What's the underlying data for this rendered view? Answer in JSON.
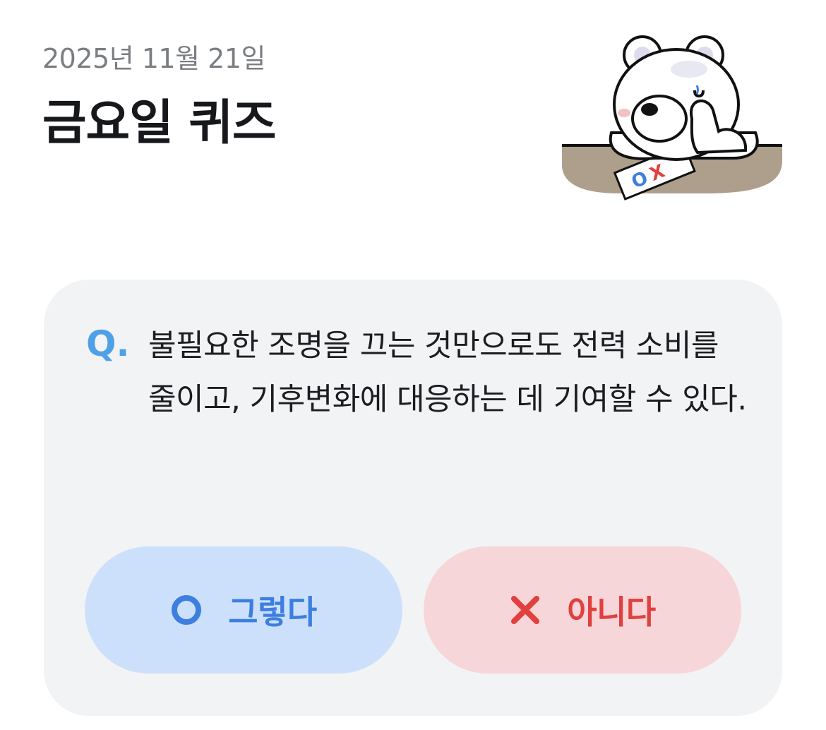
{
  "header": {
    "date": "2025년 11월 21일",
    "title": "금요일 퀴즈"
  },
  "quiz": {
    "q_mark": "Q.",
    "question": "불필요한 조명을 끄는 것만으로도 전력 소비를 줄이고, 기후변화에 대응하는 데 기여할 수 있다.",
    "answers": [
      {
        "label": "그렇다",
        "icon": "circle-o-icon",
        "color": "#3d7fe0",
        "background": "#cde0fb"
      },
      {
        "label": "아니다",
        "icon": "cross-x-icon",
        "color": "#e0403e",
        "background": "#f7d6d9"
      }
    ]
  },
  "mascot": {
    "icon": "polar-bear-mascot",
    "paper_text": "OX"
  },
  "colors": {
    "accent_blue": "#4ea1e6",
    "card_background": "#f2f3f5",
    "title_text": "#16181b",
    "date_text": "#7a7d82"
  }
}
